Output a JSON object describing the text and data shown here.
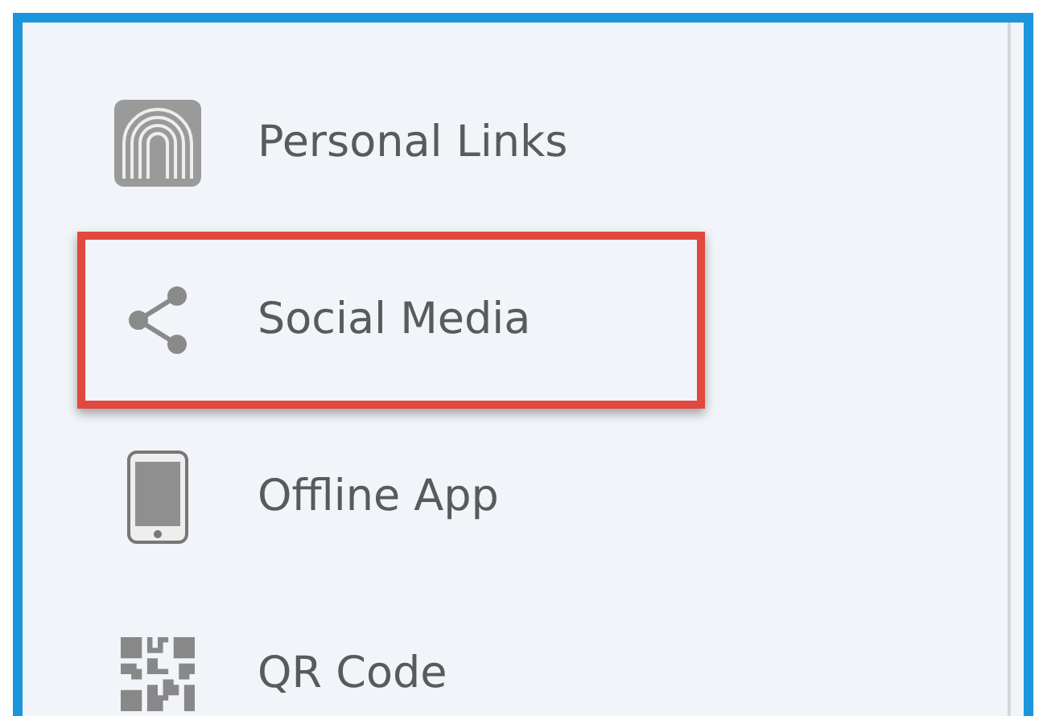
{
  "menu_items": [
    {
      "kind": "fingerprint",
      "label": "Personal Links",
      "highlighted": false
    },
    {
      "kind": "share",
      "label": "Social Media",
      "highlighted": true
    },
    {
      "kind": "phone",
      "label": "Offline App",
      "highlighted": false
    },
    {
      "kind": "qr",
      "label": "QR Code",
      "highlighted": false
    }
  ]
}
